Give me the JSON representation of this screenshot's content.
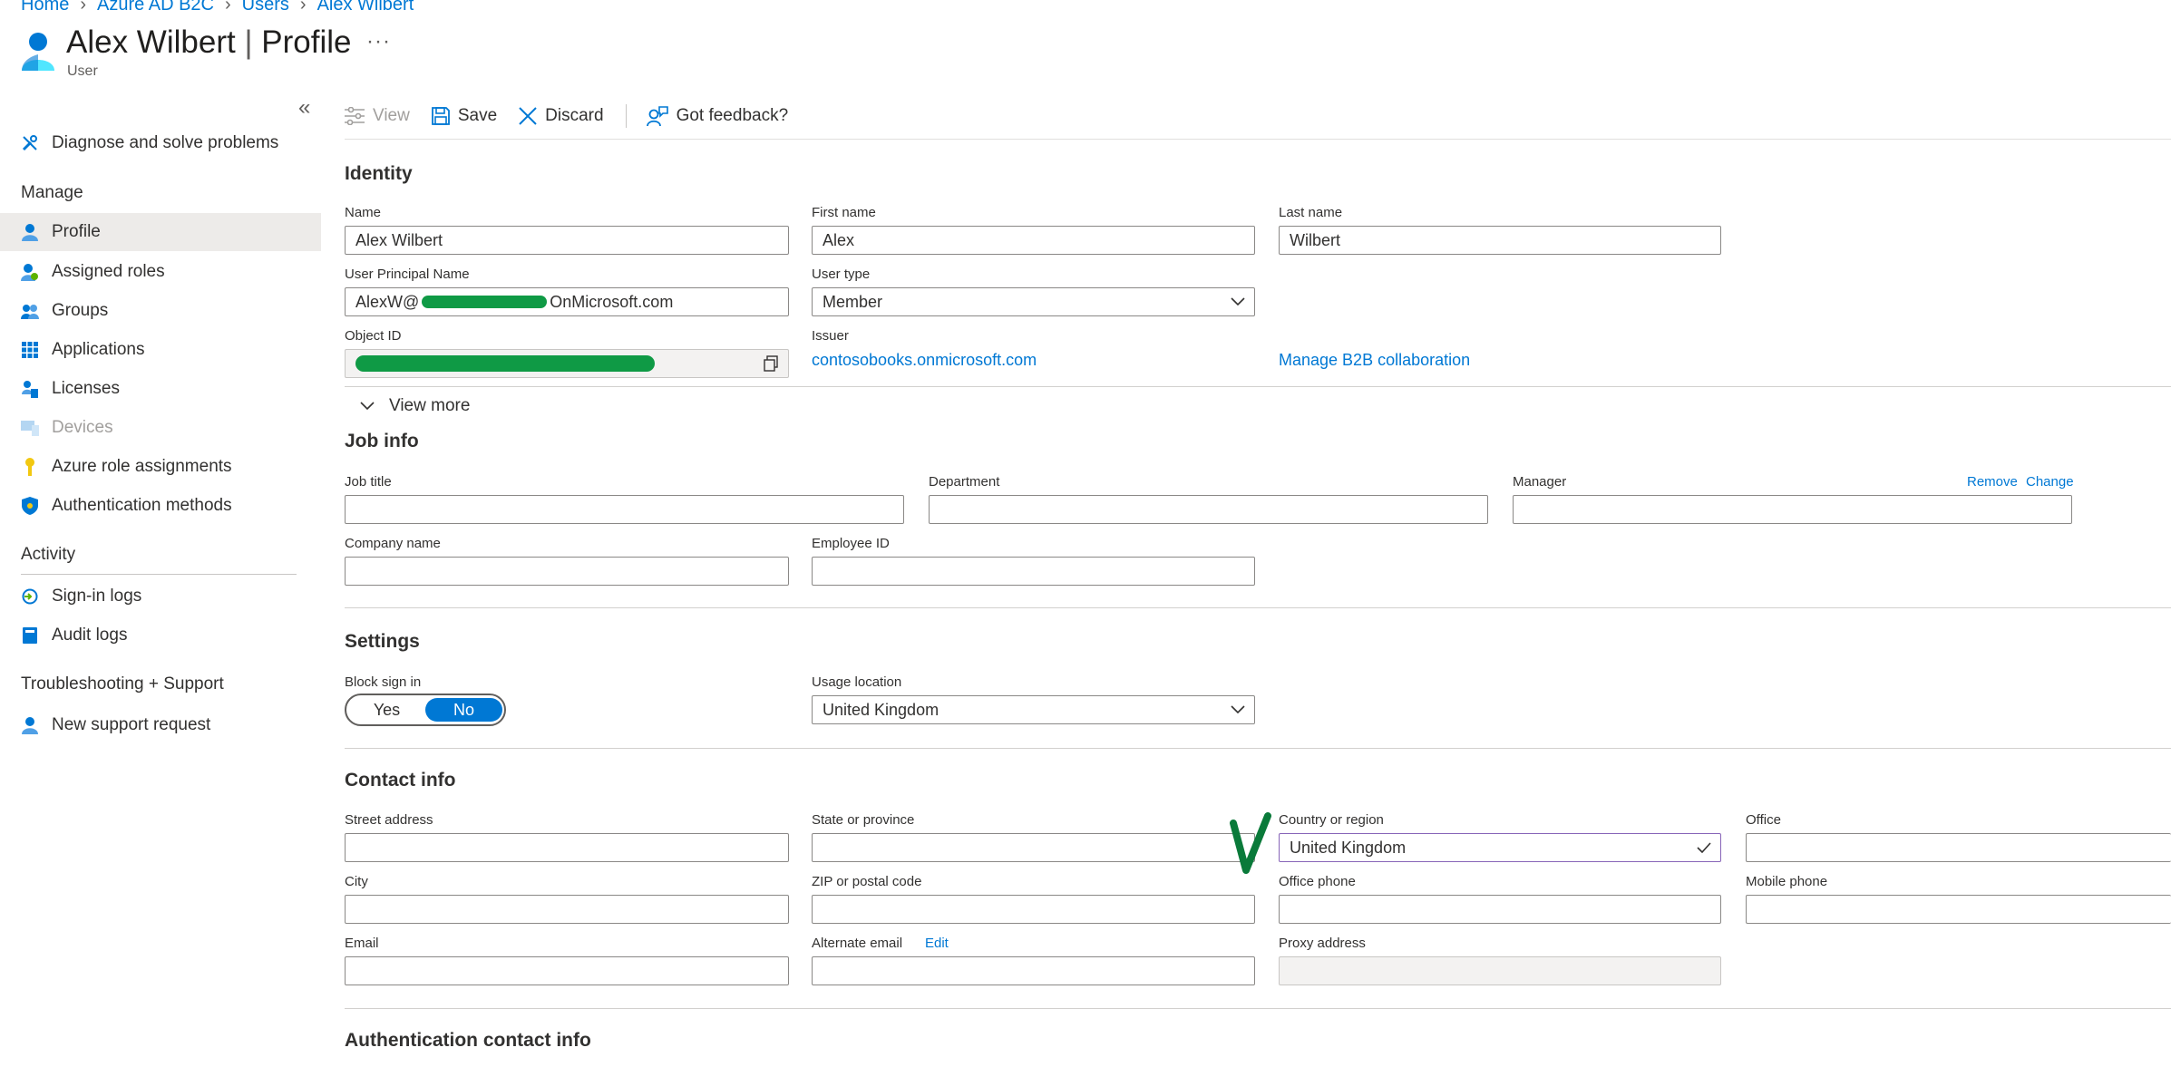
{
  "breadcrumb": [
    "Home",
    "Azure AD B2C",
    "Users",
    "Alex Wilbert"
  ],
  "header": {
    "title_name": "Alex Wilbert",
    "title_sep": "|",
    "title_page": "Profile",
    "subtitle": "User",
    "more": "···"
  },
  "sidebar": {
    "collapse": "«",
    "top_item": "Diagnose and solve problems",
    "manage_heading": "Manage",
    "manage_items": [
      "Profile",
      "Assigned roles",
      "Groups",
      "Applications",
      "Licenses",
      "Devices",
      "Azure role assignments",
      "Authentication methods"
    ],
    "activity_heading": "Activity",
    "activity_items": [
      "Sign-in logs",
      "Audit logs"
    ],
    "support_heading": "Troubleshooting + Support",
    "support_items": [
      "New support request"
    ]
  },
  "toolbar": {
    "view": "View",
    "save": "Save",
    "discard": "Discard",
    "feedback": "Got feedback?"
  },
  "identity": {
    "heading": "Identity",
    "name_label": "Name",
    "name_value": "Alex Wilbert",
    "first_label": "First name",
    "first_value": "Alex",
    "last_label": "Last name",
    "last_value": "Wilbert",
    "upn_label": "User Principal Name",
    "upn_prefix": "AlexW@",
    "upn_suffix": "OnMicrosoft.com",
    "type_label": "User type",
    "type_value": "Member",
    "objid_label": "Object ID",
    "issuer_label": "Issuer",
    "issuer_value": "contosobooks.onmicrosoft.com",
    "b2b_link": "Manage B2B collaboration",
    "view_more": "View more"
  },
  "job": {
    "heading": "Job info",
    "title_label": "Job title",
    "dept_label": "Department",
    "manager_label": "Manager",
    "remove": "Remove",
    "change": "Change",
    "company_label": "Company name",
    "empid_label": "Employee ID"
  },
  "settings": {
    "heading": "Settings",
    "block_label": "Block sign in",
    "yes": "Yes",
    "no": "No",
    "block_value": "No",
    "usage_label": "Usage location",
    "usage_value": "United Kingdom"
  },
  "contact": {
    "heading": "Contact info",
    "street_label": "Street address",
    "state_label": "State or province",
    "country_label": "Country or region",
    "country_value": "United Kingdom",
    "office_label": "Office",
    "city_label": "City",
    "zip_label": "ZIP or postal code",
    "ophone_label": "Office phone",
    "mphone_label": "Mobile phone",
    "email_label": "Email",
    "alt_label": "Alternate email",
    "alt_edit": "Edit",
    "proxy_label": "Proxy address"
  },
  "auth_contact": {
    "heading": "Authentication contact info"
  },
  "colors": {
    "accent": "#0078d4",
    "redaction": "#0f9a45",
    "annotation": "#0a7a3a"
  }
}
